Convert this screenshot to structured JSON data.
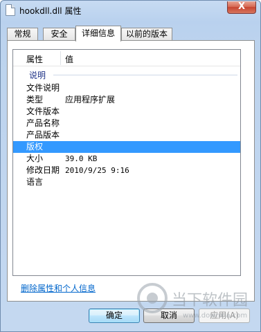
{
  "window": {
    "title": "hookdll.dll 属性",
    "close_glyph": "X"
  },
  "tabs": [
    {
      "label": "常规",
      "active": false
    },
    {
      "label": "安全",
      "active": false
    },
    {
      "label": "详细信息",
      "active": true
    },
    {
      "label": "以前的版本",
      "active": false
    }
  ],
  "details": {
    "header_property": "属性",
    "header_value": "值",
    "group": "说明",
    "rows": [
      {
        "name": "文件说明",
        "value": ""
      },
      {
        "name": "类型",
        "value": "应用程序扩展"
      },
      {
        "name": "文件版本",
        "value": ""
      },
      {
        "name": "产品名称",
        "value": ""
      },
      {
        "name": "产品版本",
        "value": ""
      },
      {
        "name": "版权",
        "value": ""
      },
      {
        "name": "大小",
        "value": "39.0 KB"
      },
      {
        "name": "修改日期",
        "value": "2010/9/25 9:16"
      },
      {
        "name": "语言",
        "value": ""
      }
    ],
    "selected_row": "版权"
  },
  "remove_link": "删除属性和个人信息",
  "buttons": {
    "ok": "确定",
    "cancel": "取消",
    "apply": "应用(A)"
  },
  "watermark": {
    "text": "当下软件园",
    "url": "www.downxia.com"
  }
}
